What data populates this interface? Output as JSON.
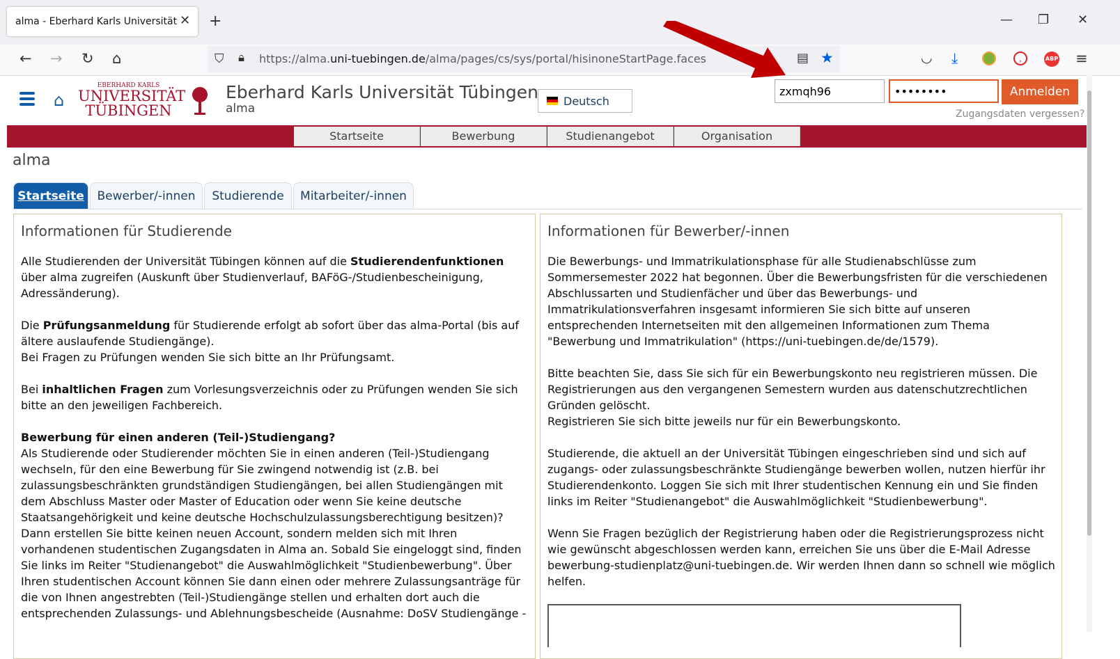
{
  "browser": {
    "tab_title": "alma - Eberhard Karls Universität Tübingen",
    "tab_close_icon": "close-icon",
    "url_host_prefix": "https://alma.",
    "url_domain": "uni-tuebingen.de",
    "url_path": "/alma/pages/cs/sys/portal/hisinoneStartPage.faces"
  },
  "header": {
    "logo_small": "EBERHARD KARLS",
    "logo_line1": "UNIVERSITÄT",
    "logo_line2": "TÜBINGEN",
    "title": "Eberhard Karls Universität Tübingen",
    "subtitle": "alma",
    "language": "Deutsch",
    "username_value": "zxmqh96",
    "password_value": "••••••••",
    "login_label": "Anmelden",
    "forgot_label": "Zugangsdaten vergessen?"
  },
  "main_nav": [
    "Startseite",
    "Bewerbung",
    "Studienangebot",
    "Organisation"
  ],
  "page": {
    "heading": "alma",
    "tabs": [
      "Startseite",
      "Bewerber/-innen",
      "Studierende",
      "Mitarbeiter/-innen"
    ]
  },
  "panels": {
    "students": {
      "title": "Informationen für Studierende",
      "p1_a": "Alle Studierenden der Universität Tübingen können auf die ",
      "p1_b": "Studierendenfunktionen",
      "p1_c": " über alma zugreifen (Auskunft über Studienverlauf, BAFöG-/Studienbescheinigung, Adressänderung).",
      "p2_a": "Die ",
      "p2_b": "Prüfungsanmeldung",
      "p2_c": " für Studierende erfolgt ab sofort über das alma-Portal (bis auf ältere auslaufende Studiengänge).",
      "p2_d": "Bei Fragen zu Prüfungen wenden Sie sich bitte an Ihr Prüfungsamt.",
      "p3_a": "Bei ",
      "p3_b": "inhaltlichen Fragen",
      "p3_c": " zum Vorlesungsverzeichnis oder zu Prüfungen wenden Sie sich bitte an den jeweiligen Fachbereich.",
      "p4_title": "Bewerbung für einen anderen (Teil-)Studiengang?",
      "p4_text": "Als Studierende oder Studierender möchten Sie in einen anderen (Teil-)Studiengang wechseln, für den eine Bewerbung für Sie zwingend notwendig ist (z.B. bei zulassungsbeschränkten grundständigen Studiengängen, bei allen Studiengängen mit dem Abschluss Master oder Master of Education oder wenn Sie keine deutsche Staatsangehörigkeit und keine deutsche Hochschulzulassungsberechtigung besitzen)? Dann erstellen Sie bitte keinen neuen Account, sondern melden sich mit Ihren vorhandenen studentischen Zugangsdaten in Alma an. Sobald Sie eingeloggt sind, finden Sie links im Reiter \"Studienangebot\" die Auswahlmöglichkeit \"Studienbewerbung\". Über Ihren studentischen Account können Sie dann einen oder mehrere Zulassungsanträge für die von Ihnen angestrebten (Teil-)Studiengänge stellen und erhalten dort auch die entsprechenden Zulassungs- und Ablehnungsbescheide (Ausnahme: DoSV Studiengänge -"
    },
    "applicants": {
      "title": "Informationen für Bewerber/-innen",
      "p1": "Die Bewerbungs- und Immatrikulationsphase für alle Studienabschlüsse zum Sommersemester 2022 hat begonnen. Über die Bewerbungsfristen für die verschiedenen Abschlussarten und Studienfächer und über das Bewerbungs- und Immatrikulationsverfahren insgesamt informieren Sie sich bitte auf unseren entsprechenden Internetseiten mit den allgemeinen Informationen zum Thema \"Bewerbung und Immatrikulation\" (https://uni-tuebingen.de/de/1579).",
      "p2": "Bitte beachten Sie, dass Sie sich für ein Bewerbungskonto neu registrieren müssen. Die Registrierungen aus den vergangenen Semestern wurden aus datenschutzrechtlichen Gründen gelöscht.",
      "p2b": "Registrieren Sie sich bitte jeweils nur für ein Bewerbungskonto.",
      "p3": "Studierende, die aktuell an der Universität Tübingen eingeschrieben sind und sich auf zugangs- oder zulassungsbeschränkte Studiengänge bewerben wollen, nutzen hierfür ihr Studierendenkonto. Loggen Sie sich mit Ihrer studentischen Kennung ein und Sie finden links im Reiter \"Studienangebot\" die Auswahlmöglichkeit \"Studienbewerbung\".",
      "p4": "Wenn Sie Fragen bezüglich der Registrierung haben oder die Registrierungsprozess nicht wie gewünscht abgeschlossen werden kann, erreichen Sie uns über die E-Mail Adresse bewerbung-studienplatz@uni-tuebingen.de. Wir werden Ihnen dann so schnell wie möglich helfen."
    }
  },
  "colors": {
    "accent_red": "#a5132d",
    "login_orange": "#e05a2a",
    "tab_blue": "#125da8",
    "annotation_arrow": "#c00000"
  }
}
